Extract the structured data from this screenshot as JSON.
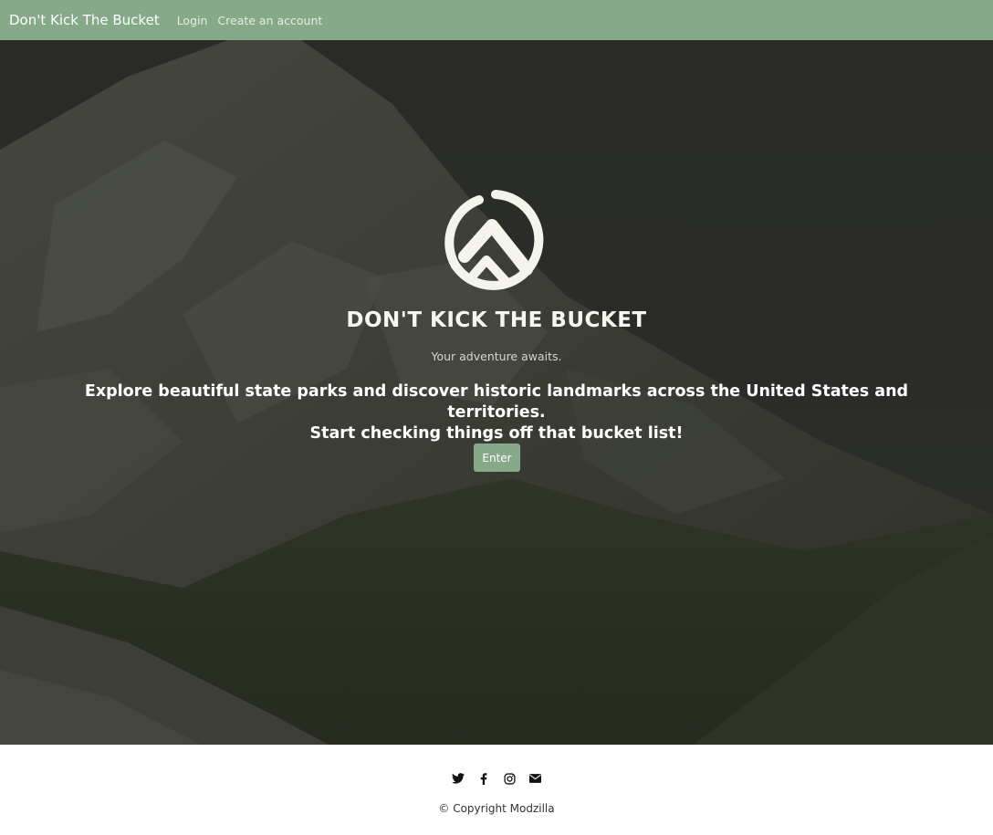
{
  "navbar": {
    "brand": "Don't Kick The Bucket",
    "links": [
      {
        "label": "Login"
      },
      {
        "label": "Create an account"
      }
    ],
    "color": "#86a98a"
  },
  "hero": {
    "title": "DON'T KICK THE BUCKET",
    "tagline": "Your adventure awaits.",
    "description_line1": "Explore beautiful state parks and discover historic landmarks across the United States and territories.",
    "description_line2": "Start checking things off that bucket list!",
    "button_label": "Enter",
    "logo_icon": "mountain-circle-logo"
  },
  "footer": {
    "social_icons": [
      "twitter-icon",
      "facebook-icon",
      "instagram-icon",
      "envelope-icon"
    ],
    "copyright": "© Copyright Modzilla"
  }
}
